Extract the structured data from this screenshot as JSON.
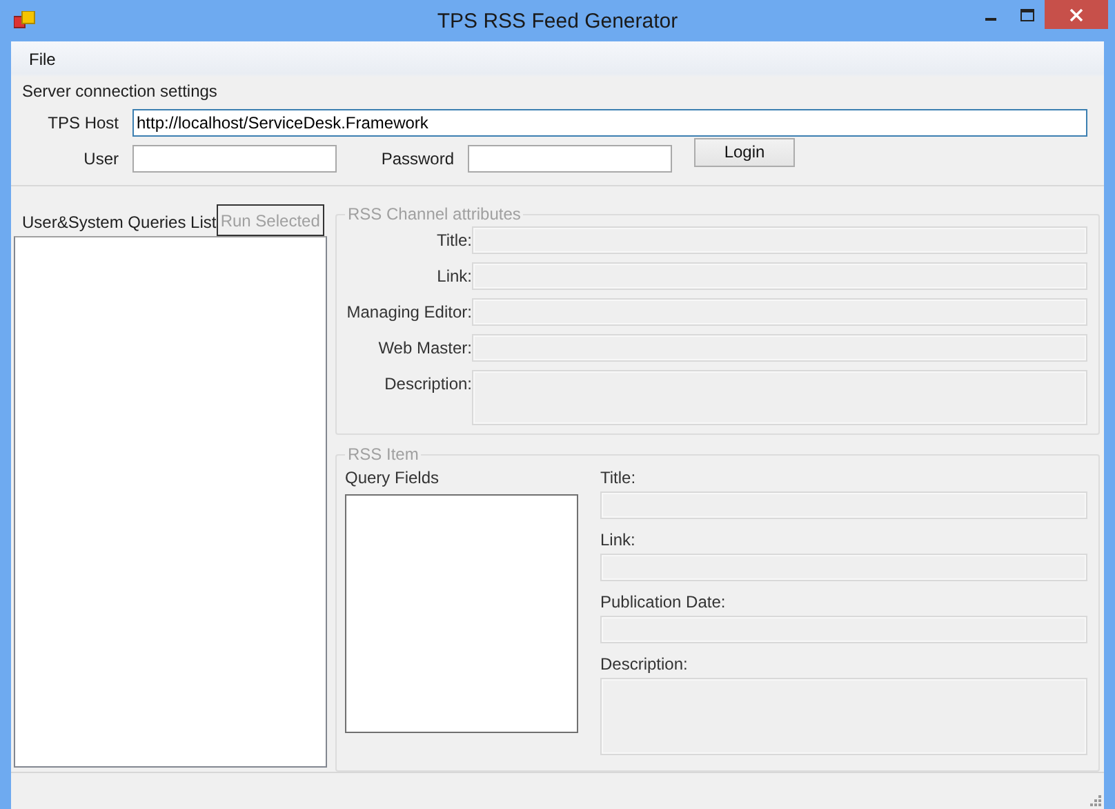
{
  "window": {
    "title": "TPS RSS Feed Generator"
  },
  "menu": [
    {
      "label": "File"
    }
  ],
  "server": {
    "title": "Server connection settings",
    "host": {
      "label": "TPS Host",
      "value": "http://localhost/ServiceDesk.Framework"
    },
    "user": {
      "label": "User"
    },
    "password": {
      "label": "Password"
    },
    "login": {
      "label": "Login"
    }
  },
  "queries": {
    "label": "User&System Queries List",
    "run_button": {
      "label": "Run Selected",
      "disabled": true
    }
  },
  "channel": {
    "title": "RSS Channel attributes",
    "disabled": true,
    "fields": [
      {
        "label": "Title:",
        "kind": "line"
      },
      {
        "label": "Link:",
        "kind": "line"
      },
      {
        "label": "Managing Editor:",
        "kind": "line"
      },
      {
        "label": "Web Master:",
        "kind": "line"
      },
      {
        "label": "Description:",
        "kind": "area"
      }
    ]
  },
  "item": {
    "title": "RSS Item",
    "disabled": true,
    "query_fields_label": "Query Fields",
    "fields": [
      {
        "label": "Title:",
        "kind": "line"
      },
      {
        "label": "Link:",
        "kind": "line"
      },
      {
        "label": "Publication Date:",
        "kind": "line"
      },
      {
        "label": "Description:",
        "kind": "area"
      }
    ]
  }
}
